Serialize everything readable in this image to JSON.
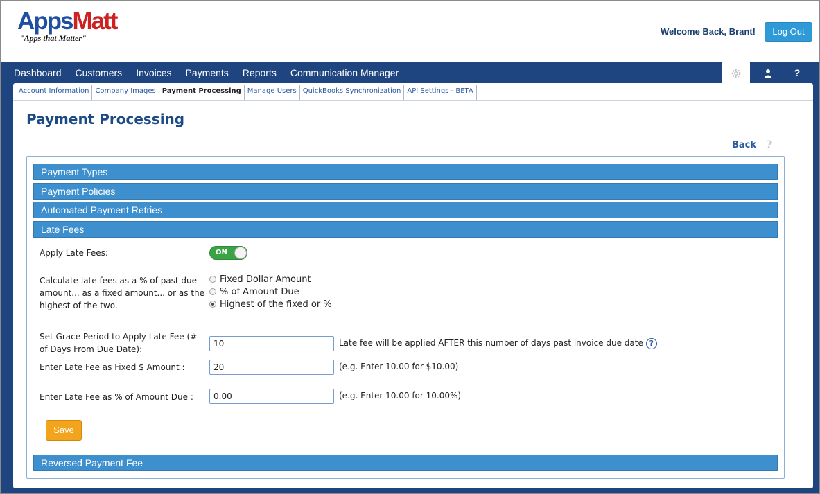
{
  "header": {
    "logo_part1": "Apps",
    "logo_part2": "Matt",
    "tagline": "\"Apps that Matter\"",
    "welcome": "Welcome Back, Brant!",
    "logout_label": "Log Out"
  },
  "main_nav": [
    "Dashboard",
    "Customers",
    "Invoices",
    "Payments",
    "Reports",
    "Communication Manager"
  ],
  "tools": {
    "gear_icon": "gear-icon",
    "user_icon": "user-icon",
    "help_label": "?"
  },
  "sub_nav": {
    "items": [
      "Account Information",
      "Company Images",
      "Payment Processing",
      "Manage Users",
      "QuickBooks Synchronization",
      "API Settings - BETA"
    ],
    "active": "Payment Processing"
  },
  "page": {
    "title": "Payment Processing",
    "back_label": "Back",
    "help_label": "?"
  },
  "sections": [
    "Payment Types",
    "Payment Policies",
    "Automated Payment Retries",
    "Late Fees",
    "Reversed Payment Fee"
  ],
  "late_fees": {
    "apply_label": "Apply Late Fees:",
    "toggle_value": "ON",
    "calc_label": "Calculate late fees as a % of past due amount... as a fixed amount... or as the highest of the two.",
    "calc_options": [
      "Fixed Dollar Amount",
      "% of Amount Due",
      "Highest of the fixed or %"
    ],
    "calc_selected": "Highest of the fixed or %",
    "grace_label": "Set Grace Period to Apply Late Fee (# of Days From Due Date):",
    "grace_value": "10",
    "grace_hint": "Late fee will be applied AFTER this number of days past invoice due date",
    "fixed_label": "Enter Late Fee as Fixed $ Amount :",
    "fixed_value": "20",
    "fixed_hint": "(e.g. Enter 10.00 for $10.00)",
    "percent_label": "Enter Late Fee as % of Amount Due :",
    "percent_value": "0.00",
    "percent_hint": "(e.g. Enter 10.00 for 10.00%)",
    "save_label": "Save"
  },
  "colors": {
    "nav_band": "#1f4581",
    "accordion": "#3d8fcd",
    "save_button": "#f2a41c",
    "toggle_on": "#3aa346",
    "logout_button": "#2e9bd8"
  }
}
